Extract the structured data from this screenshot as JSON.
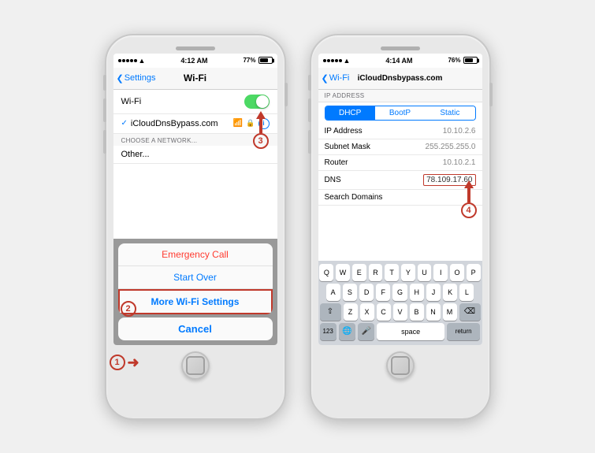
{
  "phone1": {
    "status": {
      "time": "4:12 AM",
      "signal": "●●●●●",
      "wifi": "▲",
      "battery": "77%"
    },
    "nav": {
      "back": "Settings",
      "title": "Wi-Fi"
    },
    "wifi_toggle_label": "Wi-Fi",
    "section_header": "CHOOSE A NETWORK...",
    "connected_network": "iCloudDnsBypass.com",
    "other_label": "Other...",
    "action_sheet": {
      "emergency_call": "Emergency Call",
      "start_over": "Start Over",
      "more_wifi": "More Wi-Fi Settings",
      "cancel": "Cancel"
    },
    "annotations": {
      "one": "1",
      "two": "2",
      "three": "3"
    }
  },
  "phone2": {
    "status": {
      "time": "4:14 AM",
      "battery": "76%"
    },
    "nav": {
      "back": "Wi-Fi",
      "title": "iCloudDnsbypass.com"
    },
    "ip_section": "IP ADDRESS",
    "segments": [
      "DHCP",
      "BootP",
      "Static"
    ],
    "rows": [
      {
        "label": "IP Address",
        "value": "10.10.2.6"
      },
      {
        "label": "Subnet Mask",
        "value": "255.255.255.0"
      },
      {
        "label": "Router",
        "value": "10.10.2.1"
      },
      {
        "label": "DNS",
        "value": "78.109.17.60",
        "highlighted": true
      },
      {
        "label": "Search Domains",
        "value": ""
      }
    ],
    "keyboard": {
      "row1": [
        "Q",
        "W",
        "E",
        "R",
        "T",
        "Y",
        "U",
        "I",
        "O",
        "P"
      ],
      "row2": [
        "A",
        "S",
        "D",
        "F",
        "G",
        "H",
        "J",
        "K",
        "L"
      ],
      "row3": [
        "Z",
        "X",
        "C",
        "V",
        "B",
        "N",
        "M"
      ],
      "bottom": [
        "123",
        "space",
        "return"
      ]
    },
    "annotations": {
      "four": "4"
    }
  }
}
